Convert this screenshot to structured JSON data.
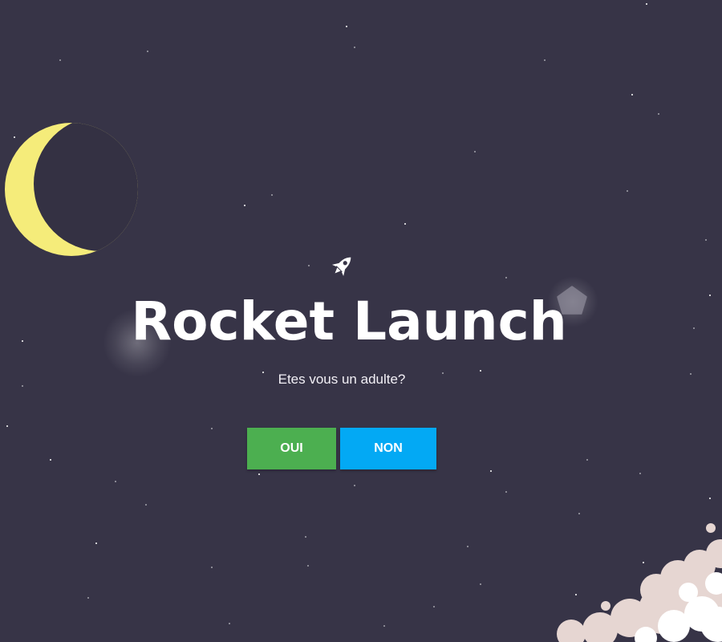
{
  "page": {
    "title": "Rocket Launch",
    "question": "Etes vous un adulte?"
  },
  "buttons": {
    "yes_label": "OUI",
    "no_label": "NON"
  },
  "icons": {
    "rocket": "rocket-icon",
    "moon": "crescent-moon"
  },
  "colors": {
    "background": "#373447",
    "moon": "#f5ec7a",
    "yes_button": "#4caf50",
    "no_button": "#03a9f4",
    "cloud": "#e6d6d2"
  }
}
